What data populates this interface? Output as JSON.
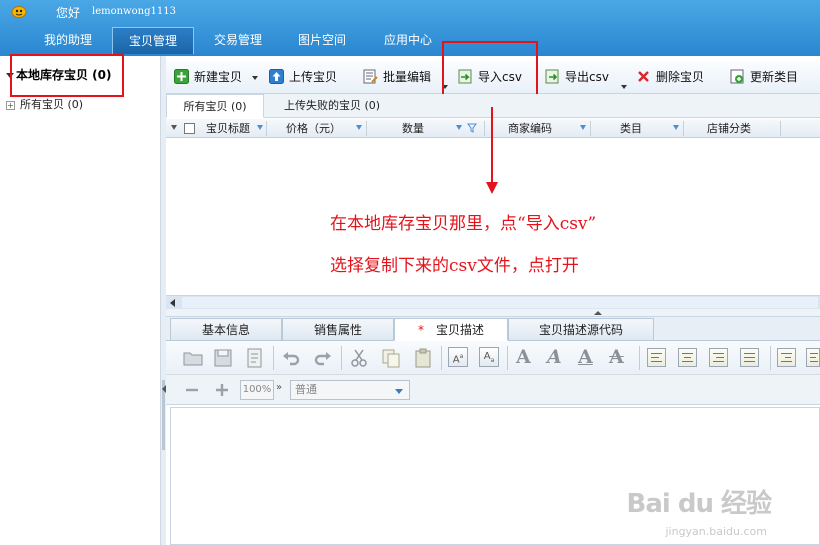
{
  "header": {
    "greeting": "您好",
    "username": "lemonwong1113",
    "nav": [
      {
        "label": "我的助理"
      },
      {
        "label": "宝贝管理"
      },
      {
        "label": "交易管理"
      },
      {
        "label": "图片空间"
      },
      {
        "label": "应用中心"
      }
    ],
    "active_nav": "宝贝管理"
  },
  "sidebar": {
    "root_label": "本地库存宝贝 (0)",
    "items": [
      {
        "label": "所有宝贝 (0)"
      }
    ]
  },
  "toolbar": {
    "new_item": "新建宝贝",
    "upload_item": "上传宝贝",
    "batch_edit": "批量编辑",
    "import_csv": "导入csv",
    "export_csv": "导出csv",
    "delete_item": "删除宝贝",
    "update_category": "更新类目"
  },
  "subtabs": [
    {
      "label": "所有宝贝 (0)"
    },
    {
      "label": "上传失败的宝贝 (0)"
    }
  ],
  "table": {
    "columns": [
      "宝贝标题",
      "价格（元）",
      "数量",
      "商家编码",
      "类目",
      "店铺分类"
    ]
  },
  "annotation": {
    "line1": "在本地库存宝贝那里，点“导入csv”",
    "line2": "选择复制下来的csv文件，点打开"
  },
  "editor": {
    "tabs": [
      {
        "label": "基本信息"
      },
      {
        "label": "销售属性"
      },
      {
        "label": "宝贝描述",
        "marker": "*"
      },
      {
        "label": "宝贝描述源代码"
      }
    ],
    "zoom": "100%",
    "font_style": "普通"
  },
  "watermark": {
    "brand": "Bai du 经验",
    "site": "jingyan.baidu.com"
  },
  "colors": {
    "header_blue": "#2a86d0",
    "annotation_red": "#e4131b"
  }
}
